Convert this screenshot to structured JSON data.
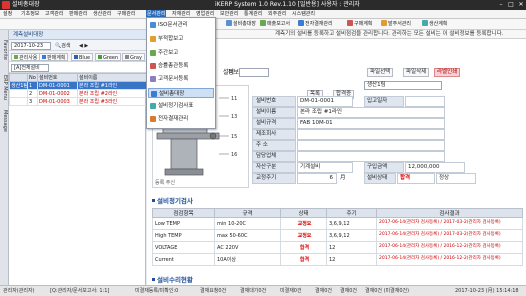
{
  "titlebar": {
    "window_title": "설비총대장",
    "system_title": "iKERP System 1.0 Rev.1.10 [일반용] 사용자 : 관리자",
    "min": "–",
    "max": "□",
    "close": "✕"
  },
  "menu": {
    "items": [
      "설정",
      "기초정보",
      "고객관리",
      "판매관리",
      "생산관리",
      "구매관리",
      "자재관리",
      "품질관리",
      "문서관리",
      "자재관리",
      "영업관리",
      "보안관리",
      "통계관리",
      "외주관리",
      "시스템관리"
    ]
  },
  "toolbar": {
    "items": [
      "설비총대장",
      "ISO문서관리",
      "구매",
      "매출보고서",
      "전자결재관리",
      "구매계획",
      "발주서관리",
      "생산계획"
    ]
  },
  "vtabs": [
    "Favorite",
    "ERP Menu",
    "Message"
  ],
  "left": {
    "tab": "계측설비대장",
    "date": "2017-10-23",
    "search_label": "검색",
    "nav": "◀ ▶",
    "buttons": [
      "관리사용",
      "판매계획",
      "Blue",
      "Green",
      "Gray"
    ],
    "filter": "[A]전체설비",
    "columns": [
      "No",
      "설비번호",
      "설비이름"
    ],
    "rows": [
      {
        "g": "생산1팀",
        "no": "1",
        "code": "DM-01-0001",
        "name": "본라 조립 #1라인"
      },
      {
        "g": "",
        "no": "2",
        "code": "DM-01-0002",
        "name": "본라 조립 #2라인"
      },
      {
        "g": "",
        "no": "3",
        "code": "DM-01-0003",
        "name": "본라 조립 #3라인"
      }
    ]
  },
  "right": {
    "notice": "계측기의 설비를 등록하고 설비점검을 관리합니다. 관리하는 모든 설비는 이 설비정보를 등록합니다.",
    "labels": {
      "fixed": "설비",
      "info": "정보"
    },
    "team": "생산1팀",
    "buttons": {
      "photo": "사진변경",
      "delete": "사진삭제",
      "list": "목록",
      "history": "합격증",
      "file_select": "파일선택",
      "file_delete": "파일삭제",
      "print": "라벨인쇄"
    },
    "form": {
      "equip_no_label": "설비번호",
      "equip_no": "DM-01-0001",
      "in_date_label": "입고일자",
      "equip_name_label": "설비이름",
      "equip_name": "본라 조립 #1라인",
      "spec_label": "설비규격",
      "spec": "FAB 10M-01",
      "maker_label": "제조회사",
      "maker": "",
      "addr_label": "주 소",
      "addr": "",
      "manager_label": "담당업체",
      "manager": "",
      "asset_label": "자산구분",
      "asset": "기계설비",
      "price_label": "구입금액",
      "price": "12,000,000",
      "cycle_label": "교정주기",
      "cycle": "6",
      "cycle_unit": "月",
      "status_label": "설비상태",
      "status": "합격",
      "status_val": "정상"
    },
    "photo_caption": "등록 주신",
    "inspect_title": "설비정기검사",
    "grid_cols": [
      "점검항목",
      "규격",
      "상태",
      "주기",
      "검사결과"
    ],
    "grid_rows": [
      {
        "item": "Low TEMP",
        "spec": "min 10-20C",
        "state": "교정요",
        "cycle": "3,6,9,12",
        "result": "2017-06-14(관리자 검사등록) / 2017-03-2(관리자 검사등록)"
      },
      {
        "item": "High TEMP",
        "spec": "max 50-60C",
        "state": "교정요",
        "cycle": "3,6,9,12",
        "result": "2017-06-14(관리자 검사등록) / 2017-03-2(관리자 검사등록)"
      },
      {
        "item": "VOLTAGE",
        "spec": "AC 220V",
        "state": "합격",
        "cycle": "12",
        "result": "2017-06-14(관리자 검사등록) / 2016-12-2(관리자 검사등록)"
      },
      {
        "item": "Current",
        "spec": "10A이상",
        "state": "합격",
        "cycle": "12",
        "result": "2017-06-14(관리자 검사등록) / 2016-12-2(관리자 검사등록)"
      }
    ],
    "repair_title": "설비수리현황"
  },
  "dropdown": {
    "items": [
      "ISO문서관리",
      "부적합보고",
      "주간보고",
      "승률총관등록",
      "고객문서등록",
      "설비총대장",
      "설비정기검사표",
      "전자결재관리"
    ],
    "highlighted_index": 5
  },
  "status": {
    "user": "관리자(관리자)",
    "items": [
      "[Q:관리자/문서보고서: 1:1]",
      "미결재등록/미확인:0",
      "결재요청0건",
      "결재대기0건",
      "미결재0건",
      "결재0건",
      "결재0건",
      "결재0건 (미결재0건)"
    ],
    "time": "2017-10-23 (月) 15:14:18"
  },
  "colors": {
    "accent": "#2f6fb7",
    "red": "#d00000",
    "select": "#3975c6",
    "header": "#dde3ec"
  }
}
